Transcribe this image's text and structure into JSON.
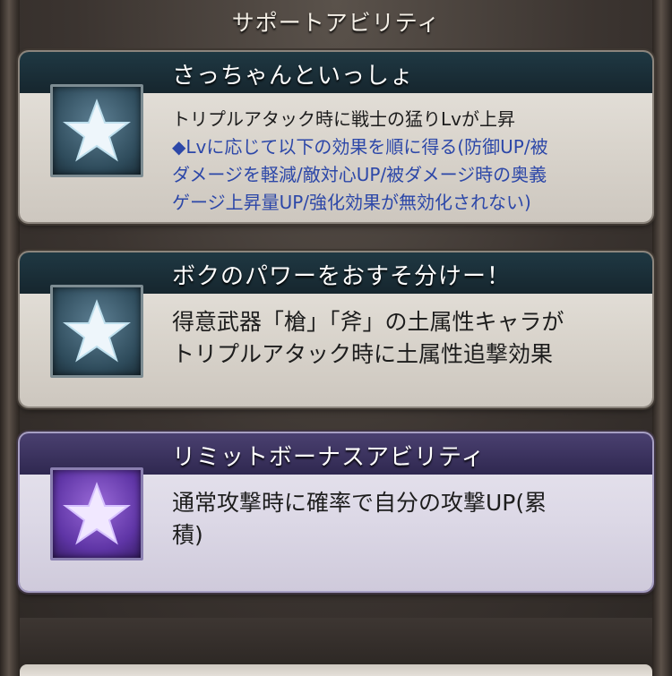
{
  "header": {
    "title": "サポートアビリティ"
  },
  "abilities": [
    {
      "name": "さっちゃんといっしょ",
      "lines": [
        "トリプルアタック時に戦士の猛りLvが上昇",
        "◆Lvに応じて以下の効果を順に得る(防御UP/被",
        "ダメージを軽減/敵対心UP/被ダメージ時の奥義",
        "ゲージ上昇量UP/強化効果が無効化されない)"
      ],
      "icon": "star-icon",
      "accent": "#1f3843"
    },
    {
      "name": "ボクのパワーをおすそ分けー！",
      "lines": [
        "得意武器「槍」「斧」の土属性キャラが",
        "トリプルアタック時に土属性追撃効果"
      ],
      "icon": "star-icon",
      "accent": "#1f3843"
    },
    {
      "name": "リミットボーナスアビリティ",
      "lines": [
        "通常攻撃時に確率で自分の攻撃UP(累",
        "積)"
      ],
      "icon": "star-icon",
      "accent": "#4a4070"
    }
  ],
  "colors": {
    "highlight_text": "#2c47a8",
    "title_bar": "#1f3843",
    "limit_title_bar": "#4a4070"
  }
}
